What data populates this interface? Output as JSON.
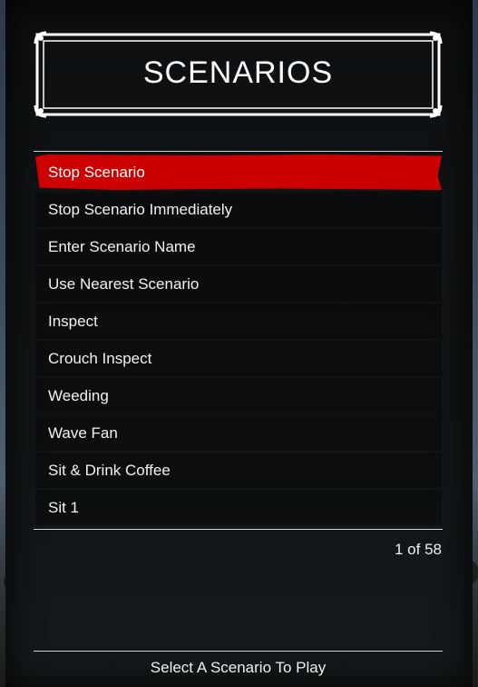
{
  "header": {
    "title": "SCENARIOS"
  },
  "menu": {
    "items": [
      {
        "label": "Stop Scenario",
        "selected": true
      },
      {
        "label": "Stop Scenario Immediately",
        "selected": false
      },
      {
        "label": "Enter Scenario Name",
        "selected": false
      },
      {
        "label": "Use Nearest Scenario",
        "selected": false
      },
      {
        "label": "Inspect",
        "selected": false
      },
      {
        "label": "Crouch Inspect",
        "selected": false
      },
      {
        "label": "Weeding",
        "selected": false
      },
      {
        "label": "Wave Fan",
        "selected": false
      },
      {
        "label": "Sit & Drink Coffee",
        "selected": false
      },
      {
        "label": "Sit 1",
        "selected": false
      }
    ]
  },
  "pager": {
    "text": "1 of 58"
  },
  "footer": {
    "hint": "Select A Scenario To Play"
  },
  "colors": {
    "selected": "#cc0000",
    "text": "#ffffff",
    "panel": "#101315"
  }
}
